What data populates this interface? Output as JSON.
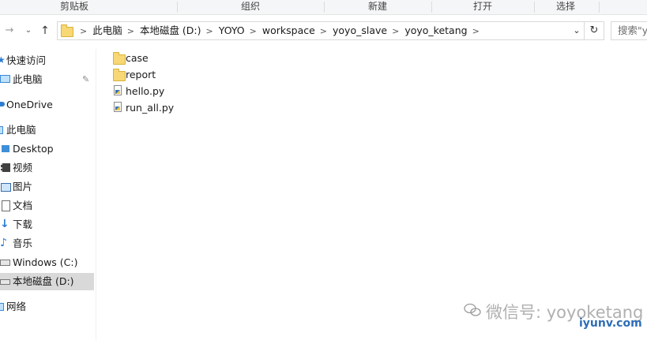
{
  "ribbon": {
    "groups": [
      "剪贴板",
      "组织",
      "新建",
      "打开",
      "选择"
    ]
  },
  "address": {
    "crumbs": [
      "此电脑",
      "本地磁盘 (D:)",
      "YOYO",
      "workspace",
      "yoyo_slave",
      "yoyo_ketang"
    ],
    "search_placeholder": "搜索\"yo"
  },
  "nav": {
    "items": [
      {
        "label": "快速访问",
        "icon": "star-icon",
        "indent": 0
      },
      {
        "label": "此电脑",
        "icon": "computer-icon",
        "indent": 0,
        "pinned": true
      },
      {
        "label": "OneDrive",
        "icon": "cloud-icon",
        "indent": 0
      },
      {
        "label": "此电脑",
        "icon": "computer-icon",
        "indent": 0
      },
      {
        "label": "Desktop",
        "icon": "desktop-folder-icon",
        "indent": 1
      },
      {
        "label": "视频",
        "icon": "video-icon",
        "indent": 1
      },
      {
        "label": "图片",
        "icon": "pictures-icon",
        "indent": 1
      },
      {
        "label": "文档",
        "icon": "documents-icon",
        "indent": 1
      },
      {
        "label": "下载",
        "icon": "download-icon",
        "indent": 1
      },
      {
        "label": "音乐",
        "icon": "music-icon",
        "indent": 1
      },
      {
        "label": "Windows (C:)",
        "icon": "drive-icon",
        "indent": 1
      },
      {
        "label": "本地磁盘 (D:)",
        "icon": "drive-icon",
        "indent": 1,
        "selected": true
      },
      {
        "label": "网络",
        "icon": "network-icon",
        "indent": 0
      }
    ]
  },
  "files": [
    {
      "name": "case",
      "type": "folder"
    },
    {
      "name": "report",
      "type": "folder"
    },
    {
      "name": "hello.py",
      "type": "python"
    },
    {
      "name": "run_all.py",
      "type": "python"
    }
  ],
  "watermark": {
    "text": "微信号: yoyoketang",
    "url": "iyunv.com"
  }
}
